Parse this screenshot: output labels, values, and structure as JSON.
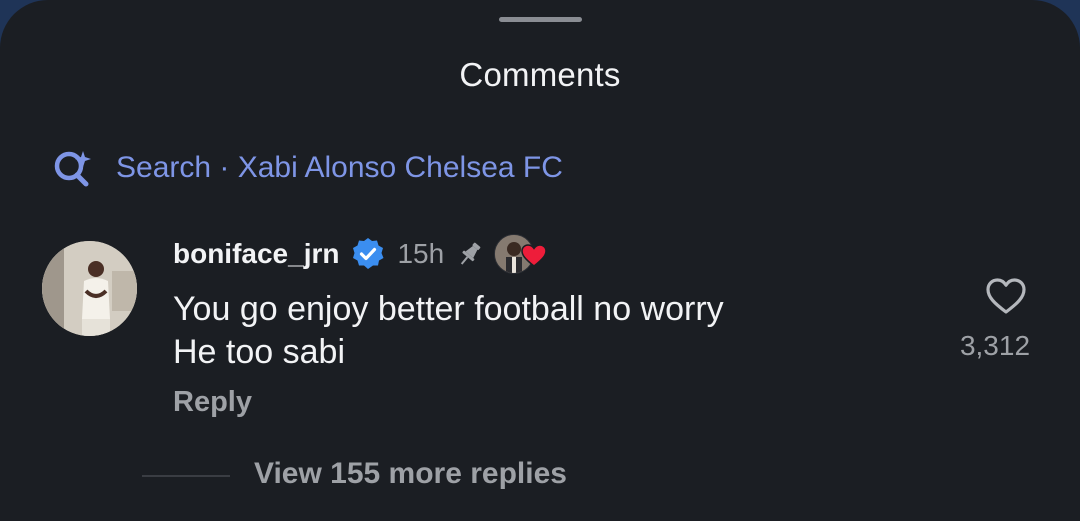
{
  "sheet": {
    "title": "Comments"
  },
  "search": {
    "label": "Search",
    "separator": " · ",
    "query": "Xabi Alonso Chelsea FC"
  },
  "comment": {
    "username": "boniface_jrn",
    "verified": true,
    "time": "15h",
    "pinned": true,
    "liked_by_author": true,
    "lines": [
      "You go enjoy better football no worry",
      "He too sabi"
    ],
    "reply_label": "Reply",
    "like_count": "3,312"
  },
  "replies": {
    "view_more_label": "View 155 more replies"
  },
  "colors": {
    "background": "#1b1e23",
    "search_accent": "#7e95e6",
    "verified_blue": "#3b8ef0",
    "heart_red": "#ee1d3a",
    "muted_text": "#9ea1a6"
  },
  "icons": [
    "search-sparkle-icon",
    "verified-badge-icon",
    "pin-icon",
    "red-heart-icon",
    "heart-outline-icon"
  ]
}
